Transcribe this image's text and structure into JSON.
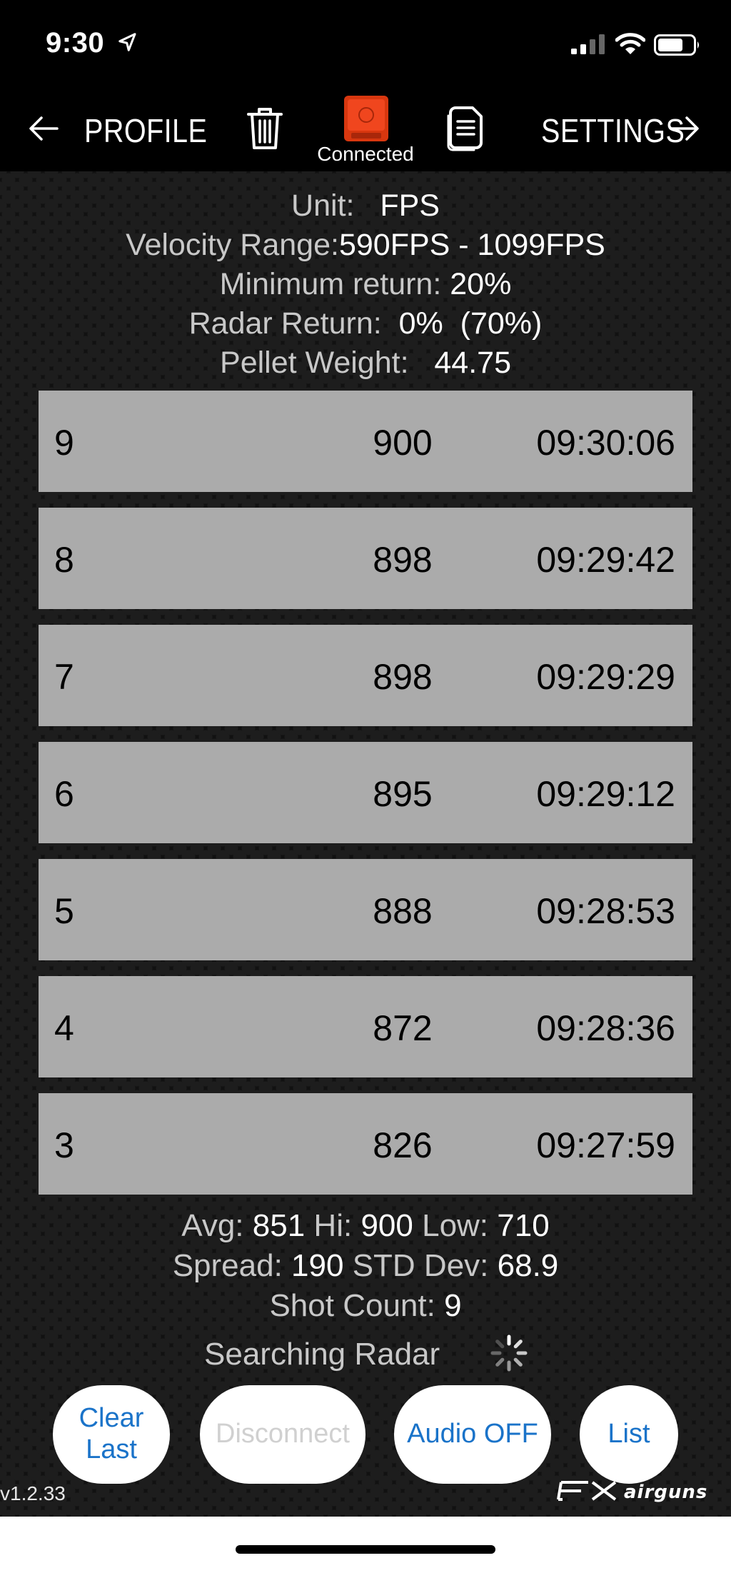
{
  "status_bar": {
    "time": "9:30",
    "icons": [
      "location-arrow-icon",
      "signal-icon",
      "wifi-icon",
      "battery-icon"
    ]
  },
  "nav": {
    "back_label": "PROFILE",
    "forward_label": "SETTINGS",
    "device_status": "Connected",
    "icons": [
      "back-arrow-icon",
      "trash-icon",
      "radar-device-icon",
      "document-icon",
      "forward-arrow-icon"
    ]
  },
  "info": {
    "unit_label": "Unit:",
    "unit_value": "FPS",
    "velocity_range_label": "Velocity Range:",
    "velocity_range_value": "590FPS - 1099FPS",
    "min_return_label": "Minimum return:",
    "min_return_value": "20%",
    "radar_return_label": "Radar Return:",
    "radar_return_value": "0%  (70%)",
    "pellet_weight_label": "Pellet Weight:",
    "pellet_weight_value": "44.75"
  },
  "shots": [
    {
      "number": "9",
      "velocity": "900",
      "time": "09:30:06"
    },
    {
      "number": "8",
      "velocity": "898",
      "time": "09:29:42"
    },
    {
      "number": "7",
      "velocity": "898",
      "time": "09:29:29"
    },
    {
      "number": "6",
      "velocity": "895",
      "time": "09:29:12"
    },
    {
      "number": "5",
      "velocity": "888",
      "time": "09:28:53"
    },
    {
      "number": "4",
      "velocity": "872",
      "time": "09:28:36"
    },
    {
      "number": "3",
      "velocity": "826",
      "time": "09:27:59"
    }
  ],
  "stats": {
    "avg_label": "Avg:",
    "avg_value": "851",
    "hi_label": "Hi:",
    "hi_value": "900",
    "low_label": "Low:",
    "low_value": "710",
    "spread_label": "Spread:",
    "spread_value": "190",
    "std_label": "STD Dev:",
    "std_value": "68.9",
    "count_label": "Shot Count:",
    "count_value": "9"
  },
  "searching_text": "Searching Radar",
  "buttons": {
    "clear_line1": "Clear",
    "clear_line2": "Last",
    "disconnect": "Disconnect",
    "audio": "Audio OFF",
    "list": "List"
  },
  "version": "v1.2.33",
  "brand": {
    "logo_text": "FX airguns"
  },
  "colors": {
    "background": "#000000",
    "row_bg": "#ababab",
    "button_text": "#1a73c9",
    "device_red": "#e8401a"
  }
}
